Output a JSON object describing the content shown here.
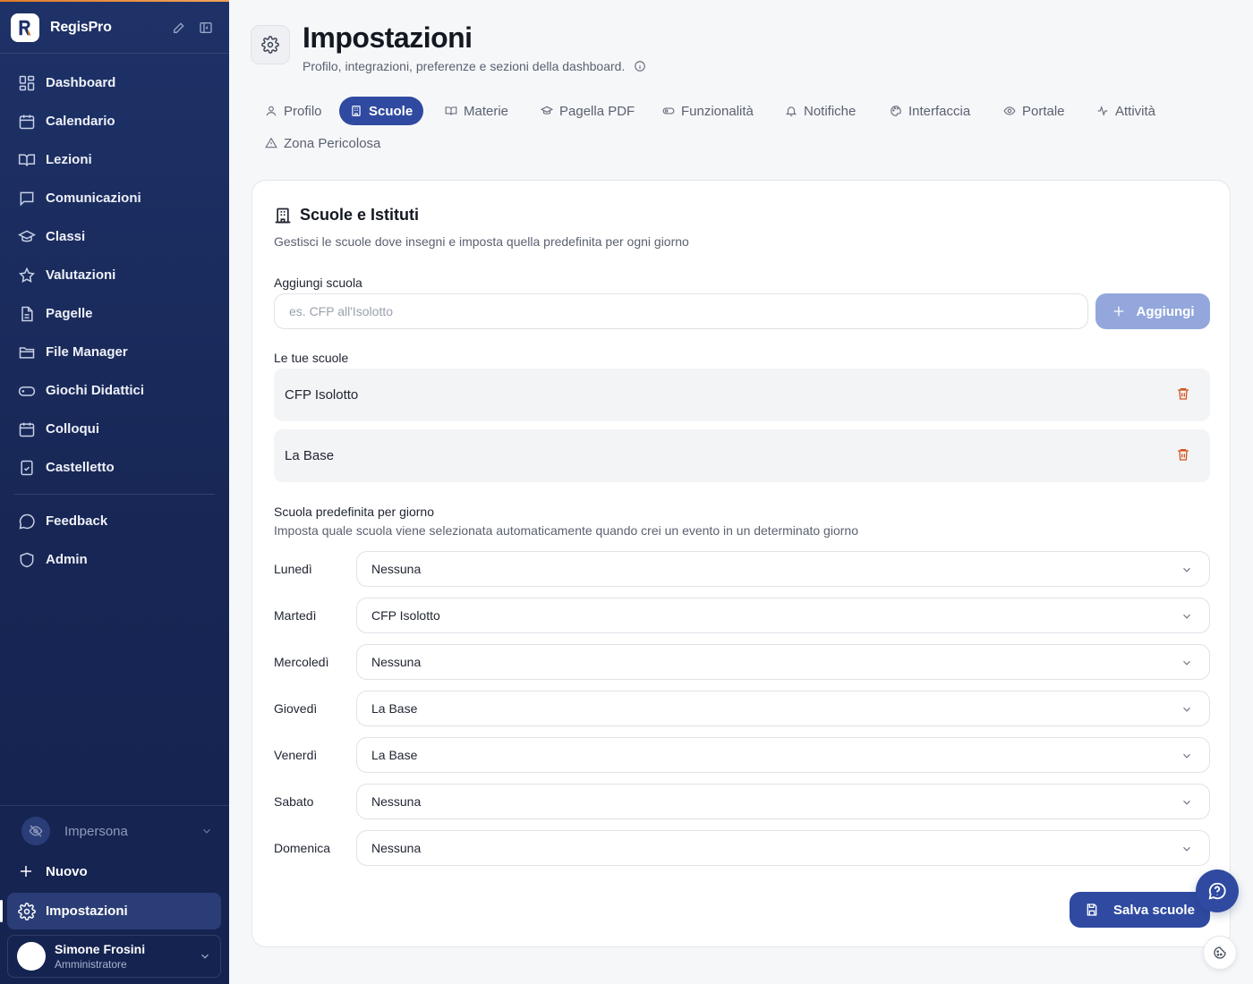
{
  "app": {
    "name": "RegisPro"
  },
  "sidebar": {
    "items": [
      {
        "label": "Dashboard",
        "icon": "dashboard-icon"
      },
      {
        "label": "Calendario",
        "icon": "calendar-icon"
      },
      {
        "label": "Lezioni",
        "icon": "book-icon"
      },
      {
        "label": "Comunicazioni",
        "icon": "message-icon"
      },
      {
        "label": "Classi",
        "icon": "graduation-cap-icon"
      },
      {
        "label": "Valutazioni",
        "icon": "star-icon"
      },
      {
        "label": "Pagelle",
        "icon": "document-icon"
      },
      {
        "label": "File Manager",
        "icon": "folder-icon"
      },
      {
        "label": "Giochi Didattici",
        "icon": "gamepad-icon"
      },
      {
        "label": "Colloqui",
        "icon": "calendar-icon"
      },
      {
        "label": "Castelletto",
        "icon": "clipboard-check-icon"
      }
    ],
    "secondary": [
      {
        "label": "Feedback",
        "icon": "chat-bubble-icon"
      },
      {
        "label": "Admin",
        "icon": "shield-icon"
      }
    ],
    "impersona": "Impersona",
    "nuovo": "Nuovo",
    "impostazioni": "Impostazioni",
    "user": {
      "name": "Simone Frosini",
      "role": "Amministratore"
    }
  },
  "header": {
    "title": "Impostazioni",
    "subtitle": "Profilo, integrazioni, preferenze e sezioni della dashboard."
  },
  "tabs": [
    {
      "label": "Profilo",
      "icon": "user-icon",
      "active": false
    },
    {
      "label": "Scuole",
      "icon": "building-icon",
      "active": true
    },
    {
      "label": "Materie",
      "icon": "book-icon",
      "active": false
    },
    {
      "label": "Pagella PDF",
      "icon": "graduation-cap-icon",
      "active": false
    },
    {
      "label": "Funzionalità",
      "icon": "toggle-icon",
      "active": false
    },
    {
      "label": "Notifiche",
      "icon": "bell-icon",
      "active": false
    },
    {
      "label": "Interfaccia",
      "icon": "palette-icon",
      "active": false
    },
    {
      "label": "Portale",
      "icon": "eye-icon",
      "active": false
    },
    {
      "label": "Attività",
      "icon": "activity-icon",
      "active": false
    },
    {
      "label": "Zona Pericolosa",
      "icon": "warning-icon",
      "active": false
    }
  ],
  "card": {
    "title": "Scuole e Istituti",
    "description": "Gestisci le scuole dove insegni e imposta quella predefinita per ogni giorno",
    "add_label": "Aggiungi scuola",
    "add_placeholder": "es. CFP all'Isolotto",
    "add_button": "Aggiungi",
    "schools_label": "Le tue scuole",
    "schools": [
      "CFP Isolotto",
      "La Base"
    ],
    "defaults_label": "Scuola predefinita per giorno",
    "defaults_desc": "Imposta quale scuola viene selezionata automaticamente quando crei un evento in un determinato giorno",
    "days": [
      {
        "day": "Lunedì",
        "value": "Nessuna"
      },
      {
        "day": "Martedì",
        "value": "CFP Isolotto"
      },
      {
        "day": "Mercoledì",
        "value": "Nessuna"
      },
      {
        "day": "Giovedì",
        "value": "La Base"
      },
      {
        "day": "Venerdì",
        "value": "La Base"
      },
      {
        "day": "Sabato",
        "value": "Nessuna"
      },
      {
        "day": "Domenica",
        "value": "Nessuna"
      }
    ],
    "save_button": "Salva scuole"
  },
  "colors": {
    "sidebar_bg": "#1e3268",
    "accent": "#2f4aa0",
    "accent_disabled": "#93a7dc",
    "danger": "#d2561f"
  }
}
